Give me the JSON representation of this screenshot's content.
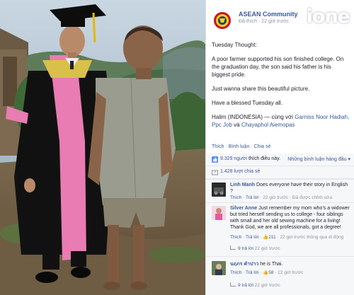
{
  "page": {
    "name": "ASEAN Community",
    "meta": "Đã thích · 22 giờ trước",
    "watermark": "ione"
  },
  "post": {
    "title": "Tuesday Thought:",
    "paragraph1": "A poor farmer supported his son finished college. On the graduation day, the son said his father is his biggest pride.",
    "paragraph2": "Just wanna share this beautiful picture.",
    "paragraph3": "Have a blessed Tuesday all.",
    "tag_author": "Halim (INDONESIA)",
    "tag_with": " — cùng với ",
    "tag_people": "Garniss Noor Hadiah, Ppc Job",
    "tag_and": " và ",
    "tag_last": "Chayaphol Aiemopas"
  },
  "actions": {
    "like": "Thích",
    "comment": "Bình luận",
    "share": "Chia sẻ"
  },
  "stats": {
    "likes_link": "9.329 người",
    "likes_text": " thích điều này.",
    "sort_label": "Những bình luận hàng đầu ▾",
    "shares": "1.428 lượt chia sẻ"
  },
  "comments": [
    {
      "author": "Linh Manh",
      "text": " Does everyone have their story in English ?",
      "like": "Thích",
      "reply": "Trả lời",
      "time": "22 giờ trước",
      "edited": "Đã được chỉnh sửa"
    },
    {
      "author": "Silver Anne",
      "text": " Just remember my mom who's a widower but tried herself sending us to college - four siblings with small and her old sewing machine for a living! Thank God, we are all professionals, got a degree!",
      "like": "Thích",
      "reply": "Trả lời",
      "likes_count": "211",
      "time": "22 giờ trước thông qua di động",
      "replies": "9 trả lời",
      "replies_time": "22 giờ trước"
    },
    {
      "author": "นฤภร คำปาว",
      "text": " he is Thai.",
      "like": "Thích",
      "reply": "Trả lời",
      "likes_count": "58",
      "time": "22 giờ trước",
      "replies": "9 trả lời",
      "replies_time": "22 giờ trước"
    }
  ]
}
